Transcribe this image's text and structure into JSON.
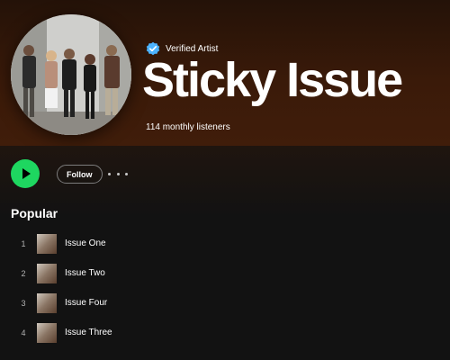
{
  "artist": {
    "verified_label": "Verified Artist",
    "name": "Sticky Issue",
    "monthly_listeners": "114 monthly listeners"
  },
  "actions": {
    "follow_label": "Follow"
  },
  "popular": {
    "title": "Popular",
    "tracks": [
      {
        "number": "1",
        "title": "Issue One"
      },
      {
        "number": "2",
        "title": "Issue Two"
      },
      {
        "number": "3",
        "title": "Issue Four"
      },
      {
        "number": "4",
        "title": "Issue Three"
      }
    ]
  },
  "colors": {
    "play_green": "#1ed760",
    "verified_blue": "#4cb3ff",
    "hero_brown": "#401d0a",
    "background": "#121212"
  },
  "icons": {
    "play": "play-icon",
    "verified": "verified-badge-icon",
    "more": "more-options-icon"
  }
}
